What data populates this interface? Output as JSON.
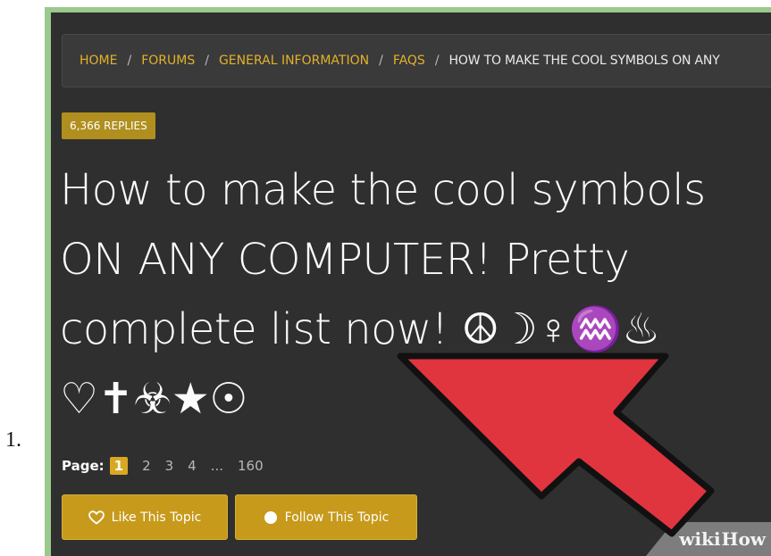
{
  "list_number": "1.",
  "breadcrumb": {
    "items": [
      "HOME",
      "FORUMS",
      "GENERAL INFORMATION",
      "FAQS"
    ],
    "separator": "/",
    "current": "HOW TO MAKE THE COOL SYMBOLS ON ANY"
  },
  "topic": {
    "replies_badge": "6,366 REPLIES",
    "title": "How to make the cool symbols ON ANY COMPUTER! Pretty complete list now! ☮☽♀♒♨ ♡✝☣★☉"
  },
  "pagination": {
    "label": "Page:",
    "current": "1",
    "pages": [
      "2",
      "3",
      "4",
      "...",
      "160"
    ]
  },
  "actions": {
    "like_label": "Like This Topic",
    "follow_label": "Follow This Topic"
  },
  "watermark": {
    "part1": "wiki",
    "part2": "How"
  },
  "colors": {
    "frame_green": "#9bc88c",
    "background": "#2f2f2f",
    "accent_gold": "#c79a1c",
    "arrow_red": "#e0343f"
  },
  "icons": {
    "like": "heart-icon",
    "follow": "circle-icon"
  }
}
